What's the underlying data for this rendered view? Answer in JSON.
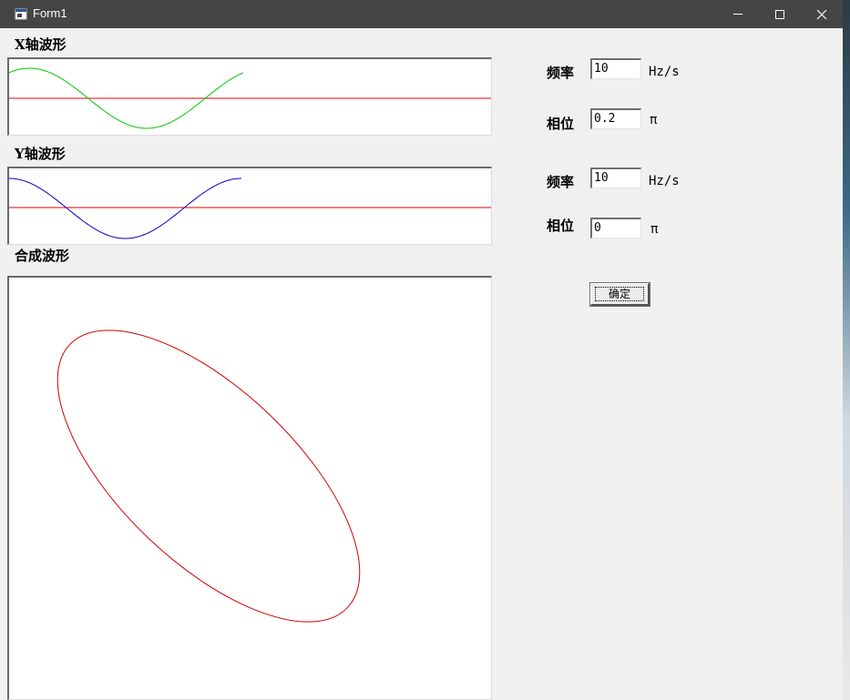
{
  "window": {
    "title": "Form1"
  },
  "x_wave": {
    "heading": "X轴波形",
    "color": "#00c800",
    "axis_color": "#e00000"
  },
  "y_wave": {
    "heading": "Y轴波形",
    "color": "#0000c0",
    "axis_color": "#e00000"
  },
  "composite": {
    "heading": "合成波形",
    "color": "#d00000"
  },
  "controls": {
    "x": {
      "freq_label": "频率",
      "freq_value": "10",
      "freq_unit": "Hz/s",
      "phase_label": "相位",
      "phase_value": "0.2",
      "phase_unit": "π"
    },
    "y": {
      "freq_label": "频率",
      "freq_value": "10",
      "freq_unit": "Hz/s",
      "phase_label": "相位",
      "phase_value": "0",
      "phase_unit": "π"
    },
    "ok_label": "确定"
  },
  "icons": [
    "app-icon",
    "minimize-icon",
    "maximize-icon",
    "close-icon"
  ]
}
